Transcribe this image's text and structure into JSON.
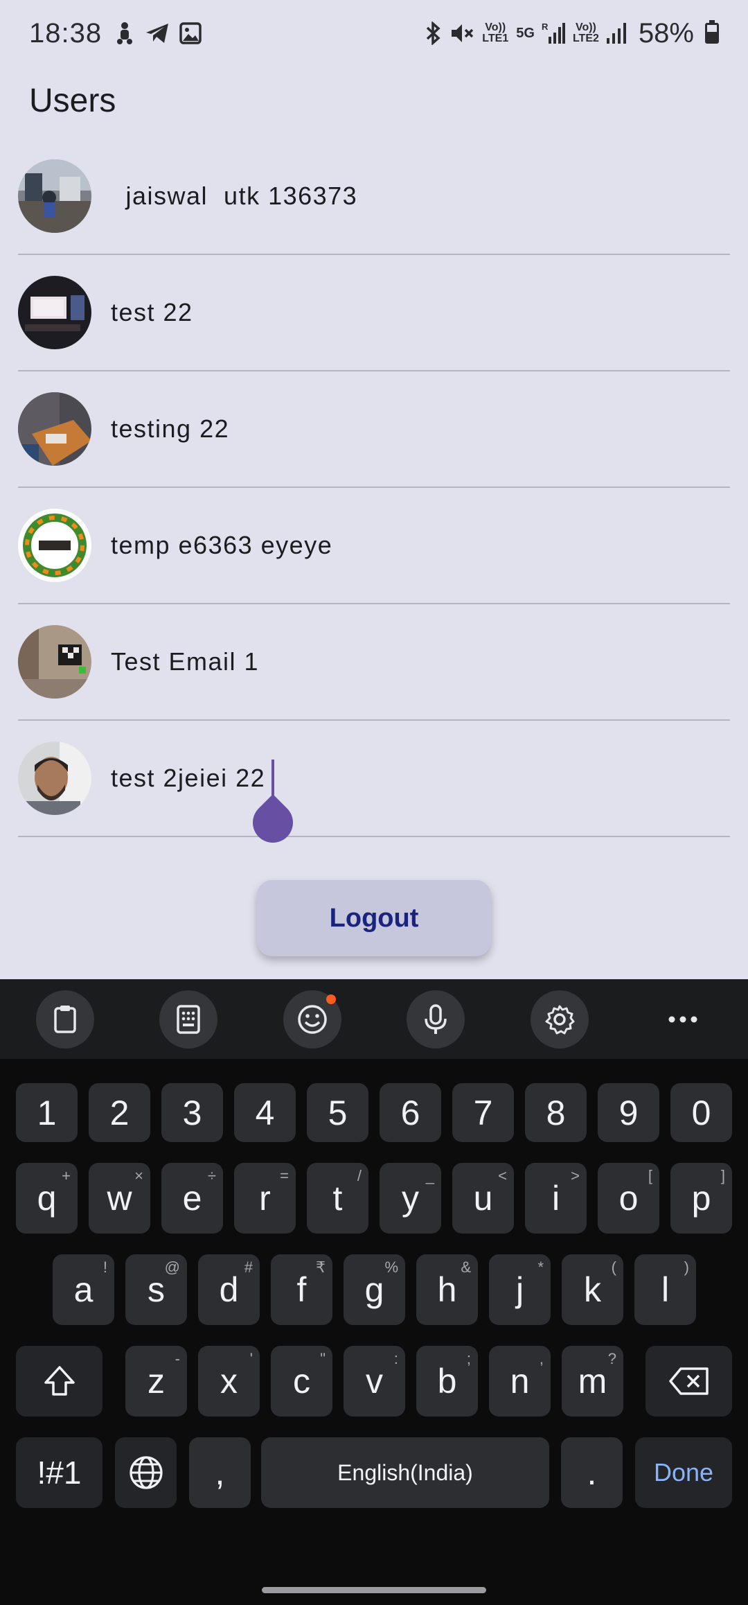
{
  "status_bar": {
    "time": "18:38",
    "left_icons": [
      "scooter-icon",
      "telegram-icon",
      "gallery-icon"
    ],
    "right_icons": [
      "bluetooth-icon",
      "mute-icon",
      "volte1-icon",
      "5g-icon",
      "signal-r-icon",
      "volte2-icon",
      "signal-icon"
    ],
    "volte1_label": "Vo)) LTE1",
    "network_label": "5G",
    "volte2_label": "Vo)) LTE2",
    "battery": "58%",
    "battery_level": 0.58
  },
  "page": {
    "title": "Users"
  },
  "users": [
    {
      "name": " jaiswal  utk 136373",
      "avatar": "room-photo"
    },
    {
      "name": "test 22",
      "avatar": "laptop-photo"
    },
    {
      "name": "testing 22",
      "avatar": "desk-photo"
    },
    {
      "name": "temp e6363 eyeye",
      "avatar": "dussehra-graphic"
    },
    {
      "name": "Test Email 1",
      "avatar": "interior-photo"
    },
    {
      "name": "test 2jeiei 22",
      "avatar": "portrait-photo"
    }
  ],
  "logout_label": "Logout",
  "keyboard": {
    "toolbar": [
      "clipboard-icon",
      "keypad-icon",
      "emoji-icon",
      "mic-icon",
      "settings-icon",
      "more-icon"
    ],
    "number_row": [
      "1",
      "2",
      "3",
      "4",
      "5",
      "6",
      "7",
      "8",
      "9",
      "0"
    ],
    "row1": [
      {
        "k": "q",
        "s": "+"
      },
      {
        "k": "w",
        "s": "×"
      },
      {
        "k": "e",
        "s": "÷"
      },
      {
        "k": "r",
        "s": "="
      },
      {
        "k": "t",
        "s": "/"
      },
      {
        "k": "y",
        "s": "_"
      },
      {
        "k": "u",
        "s": "<"
      },
      {
        "k": "i",
        "s": ">"
      },
      {
        "k": "o",
        "s": "["
      },
      {
        "k": "p",
        "s": "]"
      }
    ],
    "row2": [
      {
        "k": "a",
        "s": "!"
      },
      {
        "k": "s",
        "s": "@"
      },
      {
        "k": "d",
        "s": "#"
      },
      {
        "k": "f",
        "s": "₹"
      },
      {
        "k": "g",
        "s": "%"
      },
      {
        "k": "h",
        "s": "&"
      },
      {
        "k": "j",
        "s": "*"
      },
      {
        "k": "k",
        "s": "("
      },
      {
        "k": "l",
        "s": ")"
      }
    ],
    "row3": [
      {
        "k": "z",
        "s": "-"
      },
      {
        "k": "x",
        "s": "'"
      },
      {
        "k": "c",
        "s": "\""
      },
      {
        "k": "v",
        "s": ":"
      },
      {
        "k": "b",
        "s": ";"
      },
      {
        "k": "n",
        "s": ","
      },
      {
        "k": "m",
        "s": "?"
      }
    ],
    "symbols_label": "!#1",
    "comma_label": ",",
    "space_label": "English(India)",
    "period_label": ".",
    "done_label": "Done"
  }
}
